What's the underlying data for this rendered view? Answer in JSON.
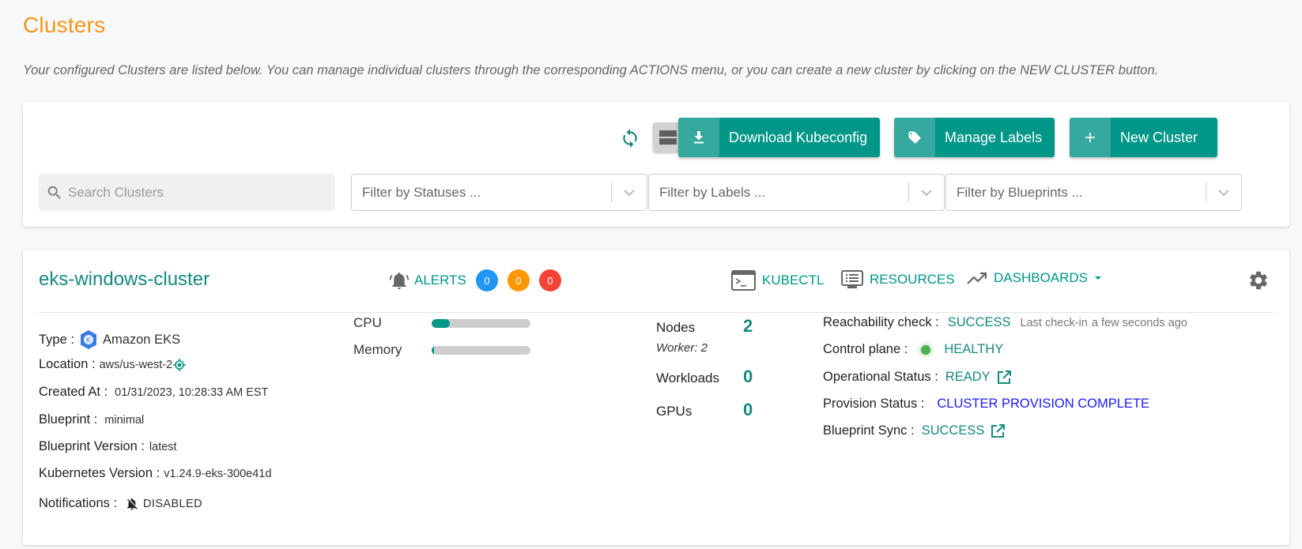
{
  "page": {
    "title": "Clusters",
    "description": "Your configured Clusters are listed below. You can manage individual clusters through the corresponding ACTIONS menu, or you can create a new cluster by clicking on the NEW CLUSTER button."
  },
  "toolbar": {
    "refresh_icon": "refresh-icon",
    "view_modes": [
      {
        "name": "card-view",
        "icon": "card-view-icon",
        "active": true
      },
      {
        "name": "list-view",
        "icon": "list-view-icon",
        "active": false
      }
    ],
    "buttons": [
      {
        "label": "Download Kubeconfig",
        "icon": "download-icon"
      },
      {
        "label": "Manage Labels",
        "icon": "tag-icon"
      },
      {
        "label": "New Cluster",
        "icon": "plus-icon"
      }
    ],
    "search": {
      "placeholder": "Search Clusters",
      "value": ""
    },
    "filters": [
      {
        "placeholder": "Filter by Statuses ..."
      },
      {
        "placeholder": "Filter by Labels ..."
      },
      {
        "placeholder": "Filter by Blueprints ..."
      }
    ]
  },
  "cluster": {
    "name": "eks-windows-cluster",
    "alerts": {
      "label": "ALERTS",
      "counts": [
        {
          "value": "0",
          "color": "#2196f3"
        },
        {
          "value": "0",
          "color": "#ff9800"
        },
        {
          "value": "0",
          "color": "#f44336"
        }
      ]
    },
    "header_links": [
      {
        "label": "KUBECTL",
        "icon": "terminal-icon"
      },
      {
        "label": "RESOURCES",
        "icon": "resources-icon"
      },
      {
        "label": "DASHBOARDS",
        "icon": "trending-icon"
      }
    ],
    "details": {
      "type_label": "Type :",
      "type_value": "Amazon EKS",
      "location_label": "Location :",
      "location_value": "aws/us-west-2",
      "created_label": "Created At :",
      "created_value": "01/31/2023, 10:28:33 AM EST",
      "blueprint_label": "Blueprint :",
      "blueprint_value": "minimal",
      "blueprint_version_label": "Blueprint Version :",
      "blueprint_version_value": "latest",
      "k8s_version_label": "Kubernetes Version :",
      "k8s_version_value": "v1.24.9-eks-300e41d",
      "notifications_label": "Notifications :",
      "notifications_value": "DISABLED"
    },
    "usage": [
      {
        "label": "CPU",
        "percent": 18
      },
      {
        "label": "Memory",
        "percent": 2
      }
    ],
    "stats": {
      "nodes_label": "Nodes",
      "nodes_value": "2",
      "worker_text": "Worker: 2",
      "workloads_label": "Workloads",
      "workloads_value": "0",
      "gpus_label": "GPUs",
      "gpus_value": "0"
    },
    "status": {
      "reachability_label": "Reachability check :",
      "reachability_value": "SUCCESS",
      "last_checkin_label": "Last check-in",
      "last_checkin_value": "a few seconds ago",
      "control_plane_label": "Control plane :",
      "control_plane_value": "HEALTHY",
      "operational_label": "Operational Status :",
      "operational_value": "READY",
      "provision_label": "Provision Status :",
      "provision_value": "CLUSTER PROVISION COMPLETE",
      "provision_color": "#1a1aff",
      "blueprint_sync_label": "Blueprint Sync :",
      "blueprint_sync_value": "SUCCESS"
    }
  }
}
